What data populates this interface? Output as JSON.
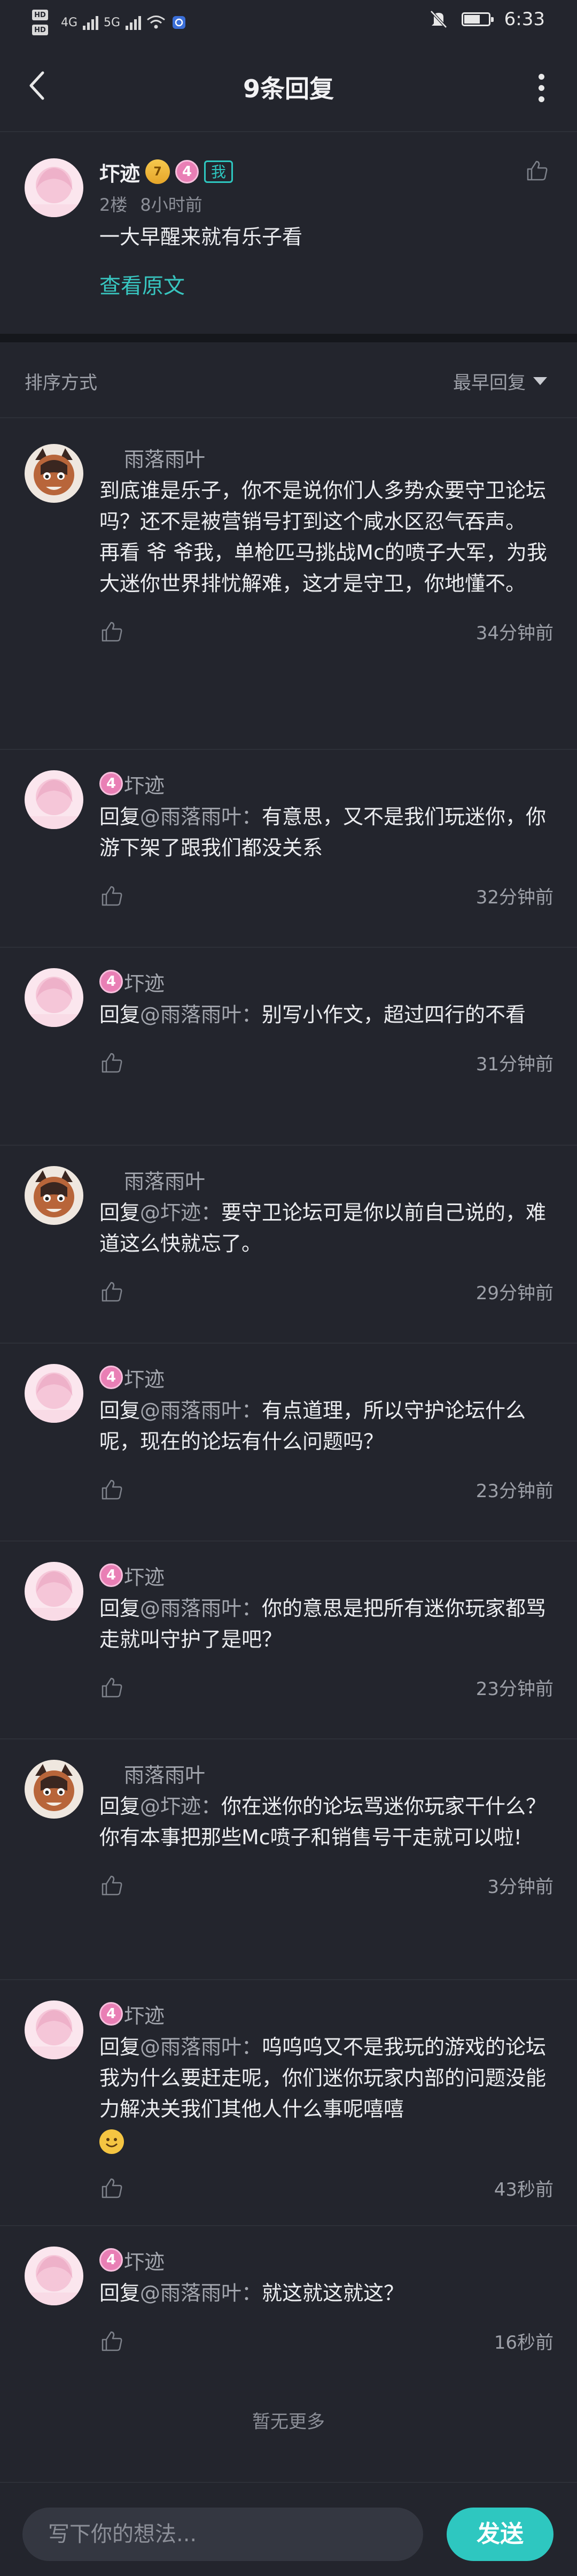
{
  "status_bar": {
    "hd1": "HD",
    "hd2": "HD",
    "net1": "4G",
    "net2": "5G",
    "time": "6:33",
    "battery_level": 0.7
  },
  "nav": {
    "title": "9条回复"
  },
  "post": {
    "username": "圷迹",
    "level_badge": "7",
    "rank_badge": "4",
    "me_tag": "我",
    "floor": "2楼",
    "time": "8小时前",
    "content": "一大早醒来就有乐子看",
    "view_original": "查看原文"
  },
  "sort": {
    "label": "排序方式",
    "value": "最早回复"
  },
  "replies": [
    {
      "username": "雨落雨叶",
      "avatar": "cat",
      "badge": "",
      "reply_prefix": "",
      "at": "",
      "content": "到底谁是乐子，你不是说你们人多势众要守卫论坛吗？还不是被营销号打到这个咸水区忍气吞声。\n再看 爷 爷我，单枪匹马挑战Mc的喷子大军，为我大迷你世界排忧解难，这才是守卫，你地懂不。",
      "time": "34分钟前"
    },
    {
      "username": "圷迹",
      "avatar": "pink",
      "badge": "4",
      "reply_prefix": "回复",
      "at": "@雨落雨叶：",
      "content": "有意思，又不是我们玩迷你，你游下架了跟我们都没关系",
      "time": "32分钟前"
    },
    {
      "username": "圷迹",
      "avatar": "pink",
      "badge": "4",
      "reply_prefix": "回复",
      "at": "@雨落雨叶：",
      "content": "别写小作文，超过四行的不看",
      "time": "31分钟前"
    },
    {
      "username": "雨落雨叶",
      "avatar": "cat",
      "badge": "",
      "reply_prefix": "回复",
      "at": "@圷迹：",
      "content": "要守卫论坛可是你以前自己说的，难道这么快就忘了。",
      "time": "29分钟前"
    },
    {
      "username": "圷迹",
      "avatar": "pink",
      "badge": "4",
      "reply_prefix": "回复",
      "at": "@雨落雨叶：",
      "content": "有点道理，所以守护论坛什么呢，现在的论坛有什么问题吗？",
      "time": "23分钟前"
    },
    {
      "username": "圷迹",
      "avatar": "pink",
      "badge": "4",
      "reply_prefix": "回复",
      "at": "@雨落雨叶：",
      "content": "你的意思是把所有迷你玩家都骂走就叫守护了是吧？",
      "time": "23分钟前"
    },
    {
      "username": "雨落雨叶",
      "avatar": "cat",
      "badge": "",
      "reply_prefix": "回复",
      "at": "@圷迹：",
      "content": "你在迷你的论坛骂迷你玩家干什么？你有本事把那些Mc喷子和销售号干走就可以啦!",
      "time": "3分钟前"
    },
    {
      "username": "圷迹",
      "avatar": "pink",
      "badge": "4",
      "reply_prefix": "回复",
      "at": "@雨落雨叶：",
      "content": "呜呜呜又不是我玩的游戏的论坛我为什么要赶走呢，你们迷你玩家内部的问题没能力解决关我们其他人什么事呢嘻嘻",
      "emoji": "smile-emoji",
      "time": "43秒前"
    },
    {
      "username": "圷迹",
      "avatar": "pink",
      "badge": "4",
      "reply_prefix": "回复",
      "at": "@雨落雨叶：",
      "content": "就这就这就这？",
      "time": "16秒前"
    }
  ],
  "no_more": "暂无更多",
  "input": {
    "placeholder": "写下你的想法...",
    "send_label": "发送"
  },
  "colors": {
    "background": "#23252d",
    "accent": "#2ec7c0",
    "badge_pink": "#e97fb5"
  }
}
